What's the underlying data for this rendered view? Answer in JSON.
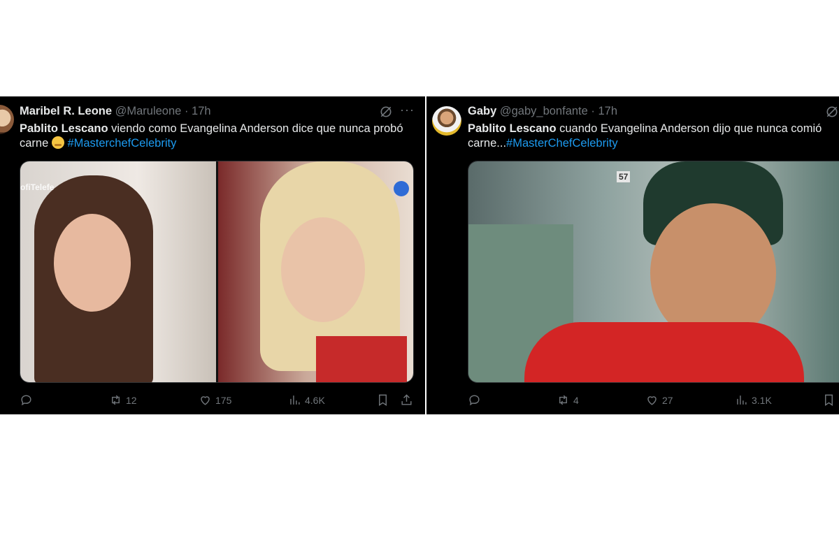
{
  "tweets": [
    {
      "author_name": "Maribel R. Leone",
      "handle": "@Maruleone",
      "time": "· 17h",
      "text_bold": "Pablito Lescano",
      "text_line1": " viendo como Evangelina Anderson dice que nunca probó",
      "text_line2": "carne ",
      "emoji": "face-with-hand-over-mouth-emoji",
      "hashtag": "#MasterchefCelebrity",
      "media_overlay_text": "ofiTelefe",
      "retweets": "12",
      "likes": "175",
      "views": "4.6K"
    },
    {
      "author_name": "Gaby",
      "handle": "@gaby_bonfante",
      "time": "· 17h",
      "text_bold": "Pablito Lescano",
      "text_line1": " cuando Evangelina Anderson dijo que nunca comió",
      "text_line2": "carne...",
      "hashtag": "#MasterChefCelebrity",
      "media_overlay_text": "57",
      "retweets": "4",
      "likes": "27",
      "views": "3.1K"
    }
  ],
  "colors": {
    "background": "#000000",
    "text": "#e7e9ea",
    "muted": "#71767b",
    "hashtag": "#1d9bf0"
  },
  "icons": [
    "grok-icon",
    "more-icon",
    "reply-icon",
    "retweet-icon",
    "like-icon",
    "views-icon",
    "bookmark-icon",
    "share-icon"
  ]
}
